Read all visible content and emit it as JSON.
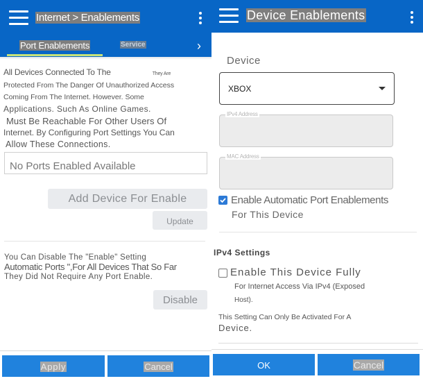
{
  "left_screen": {
    "header": {
      "title": "Internet > Enablements",
      "menu_icon": "hamburger-menu-icon",
      "overflow_icon": "more-vertical-icon"
    },
    "tabs": [
      {
        "label": "Port Enablements",
        "active": true
      },
      {
        "label": "Service",
        "active": false
      }
    ],
    "tabs_next_icon": "chevron-right-icon",
    "tab_next_glyph": "›",
    "accent_color": "#c6e37a",
    "intro_lines": [
      "All Devices Connected To The",
      "They Are",
      "Protected From The Danger Of Unauthorized Access",
      "Coming From The Internet. However. Some",
      "Applications. Such As Online Games.",
      "Must Be Reachable For Other Users Of",
      "Internet. By Configuring Port Settings You Can",
      "Allow These Connections."
    ],
    "ports_list_empty": "No Ports Enabled Available",
    "add_device_button": "Add Device For Enable",
    "update_button": "Update",
    "disable_lines": [
      "You Can Disable The \"Enable\" Setting",
      "Automatic Ports \",For All Devices That So Far",
      "They Did Not Require Any Port Enable."
    ],
    "disable_button": "Disable",
    "apply_button": "Apply",
    "cancel_button": "Cancel"
  },
  "right_screen": {
    "header": {
      "title": "Device Enablements",
      "menu_icon": "hamburger-menu-icon",
      "overflow_icon": "more-vertical-icon"
    },
    "device_label": "Device",
    "device_select": {
      "value": "XBOX"
    },
    "ipv4_field": {
      "label": "IPv4 Address",
      "value": ""
    },
    "mac_field": {
      "label": "MAC Address",
      "value": ""
    },
    "auto_port_checkbox": {
      "checked": true,
      "line1": "Enable Automatic Port Enablements",
      "line2": "For This Device"
    },
    "ipv4_settings_title": "IPv4 Settings",
    "exposed_host_checkbox": {
      "checked": false,
      "line1": "Enable This Device Fully",
      "line2": "For Internet Access Via IPv4 (Exposed",
      "line3": "Host)."
    },
    "note_lines": [
      "This Setting Can Only Be Activated For A",
      "Device."
    ],
    "ok_button": "OK",
    "cancel_button": "Cancel"
  },
  "colors": {
    "app_bar": "#0866c6",
    "primary_button": "#2082dd",
    "checkbox": "#2c7ad6"
  }
}
